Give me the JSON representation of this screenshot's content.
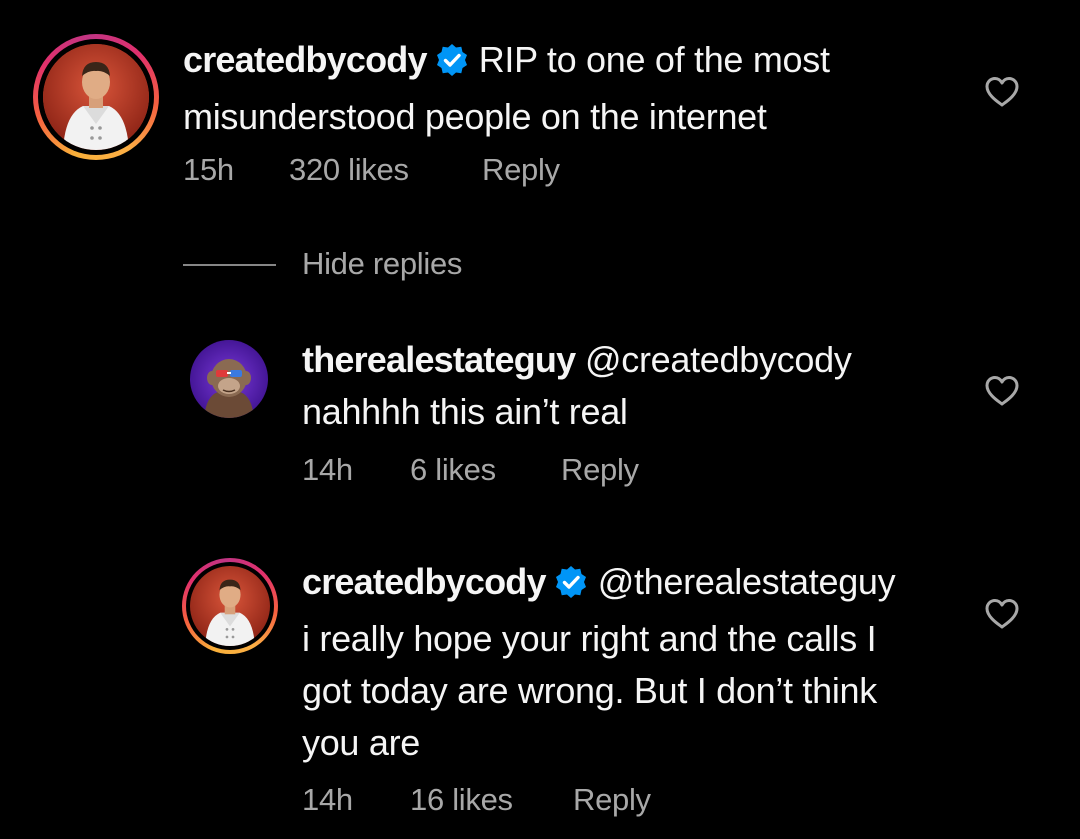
{
  "comments": [
    {
      "username": "createdbycody",
      "verified": true,
      "lines": [
        "RIP to one of the most",
        "misunderstood people on the internet"
      ],
      "time": "15h",
      "likes": "320 likes",
      "reply_label": "Reply",
      "avatar_icon": "chef-photo-avatar"
    },
    {
      "username": "therealestateguy",
      "mention": "@createdbycody",
      "lines": [
        "nahhhh this ain’t real"
      ],
      "time": "14h",
      "likes": "6 likes",
      "reply_label": "Reply",
      "avatar_icon": "ape-nft-avatar"
    },
    {
      "username": "createdbycody",
      "verified": true,
      "mention": "@therealestateguy",
      "lines": [
        "i really hope your right and the calls I",
        "got today are wrong. But I don’t think",
        "you are"
      ],
      "time": "14h",
      "likes": "16 likes",
      "reply_label": "Reply",
      "avatar_icon": "chef-photo-avatar"
    }
  ],
  "hide_replies_label": "Hide replies",
  "colors": {
    "background": "#000000",
    "primary_text": "#f5f5f5",
    "secondary_text": "#a8a8a8",
    "verified_blue": "#0095f6"
  }
}
